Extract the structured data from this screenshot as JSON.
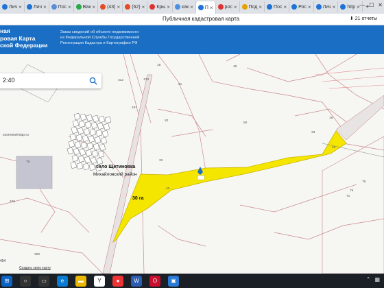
{
  "browser": {
    "tabs": [
      {
        "title": "Лич",
        "color": "#1e73d6"
      },
      {
        "title": "Лич",
        "color": "#1e73d6"
      },
      {
        "title": "Пос",
        "color": "#5b8dd9"
      },
      {
        "title": "Вак",
        "color": "#2ba84a"
      },
      {
        "title": "(43)",
        "color": "#e34c26"
      },
      {
        "title": "(62)",
        "color": "#e34c26"
      },
      {
        "title": "Кры",
        "color": "#d33"
      },
      {
        "title": "как",
        "color": "#4a90e2"
      },
      {
        "title": "П",
        "color": "#1e73d6",
        "active": true
      },
      {
        "title": "рос",
        "color": "#d33"
      },
      {
        "title": "Под",
        "color": "#e8a000"
      },
      {
        "title": "Пос",
        "color": "#1e73d6"
      },
      {
        "title": "Рос",
        "color": "#1e73d6"
      },
      {
        "title": "Лич",
        "color": "#1e73d6"
      },
      {
        "title": "http",
        "color": "#1e73d6"
      }
    ],
    "add_tab": "+",
    "win_buttons": [
      "—",
      "☐",
      "✕"
    ]
  },
  "site": {
    "logo_lines": [
      "ная",
      "ровая Карта",
      "ской Федерации"
    ],
    "title": "Публичная кадастровая карта",
    "desc_lines": [
      "Заказ сведений об объекте недвижимости",
      "из Федеральной Службы Государственной",
      "Регистрации Кадастра и Картографии РФ"
    ],
    "counter": "21 отчеты"
  },
  "search": {
    "value": "2:40"
  },
  "map": {
    "village": "село Щетиновка",
    "district": "Михайловский район",
    "area": "30 га",
    "parcel_numbers": [
      "19",
      "312",
      "178",
      "21",
      "49",
      "197",
      "33",
      "20",
      "76",
      "16",
      "40",
      "50",
      "33",
      "78",
      "76",
      "40",
      "106",
      "71",
      "309"
    ],
    "footer_link": "Создать свою карту",
    "watermark": "xosrreestrmap.ru",
    "scale": "454"
  },
  "colors": {
    "parcel_fill": "#f5e600",
    "header_blue": "#1a6fc4",
    "taskbar": "#1b1f26"
  }
}
